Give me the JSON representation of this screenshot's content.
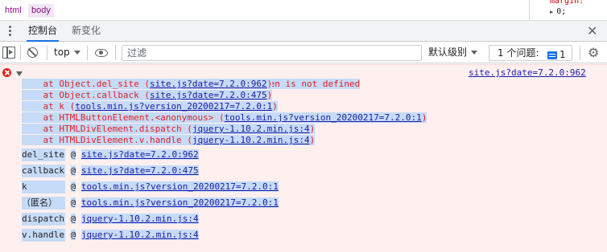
{
  "breadcrumbs": [
    "html",
    "body"
  ],
  "styles_peek": {
    "property": "margin:",
    "value": "0;"
  },
  "drawer": {
    "tabs": [
      {
        "label": "控制台",
        "active": true
      },
      {
        "label": "新变化",
        "active": false
      }
    ],
    "close_glyph": "✕"
  },
  "toolbar": {
    "context": "top",
    "filter_placeholder": "过滤",
    "levels_label": "默认级别",
    "issues_label": "1 个问题:",
    "issues_count": "1",
    "gear_glyph": "⚙"
  },
  "error": {
    "header": "Uncaught ReferenceError: recycle_bin_db_open is not defined",
    "source": "site.js?date=7.2.0:962",
    "frames": [
      {
        "prefix": "    at Object.del_site (",
        "link": "site.js?date=7.2.0:962",
        "suffix": ")"
      },
      {
        "prefix": "    at Object.callback (",
        "link": "site.js?date=7.2.0:475",
        "suffix": ")"
      },
      {
        "prefix": "    at k (",
        "link": "tools.min.js?version_20200217=7.2.0:1",
        "suffix": ")"
      },
      {
        "prefix": "    at HTMLButtonElement.<anonymous> (",
        "link": "tools.min.js?version_20200217=7.2.0:1",
        "suffix": ")"
      },
      {
        "prefix": "    at HTMLDivElement.dispatch (",
        "link": "jquery-1.10.2.min.js:4",
        "suffix": ")"
      },
      {
        "prefix": "    at HTMLDivElement.v.handle (",
        "link": "jquery-1.10.2.min.js:4",
        "suffix": ")"
      }
    ],
    "stack_table": [
      {
        "fn": "del_site",
        "at": "@",
        "link": "site.js?date=7.2.0:962"
      },
      {
        "fn": "callback",
        "at": "@",
        "link": "site.js?date=7.2.0:475"
      },
      {
        "fn": "k",
        "at": "@",
        "link": "tools.min.js?version_20200217=7.2.0:1"
      },
      {
        "fn": "（匿名）",
        "at": "@",
        "link": "tools.min.js?version_20200217=7.2.0:1"
      },
      {
        "fn": "dispatch",
        "at": "@",
        "link": "jquery-1.10.2.min.js:4"
      },
      {
        "fn": "v.handle",
        "at": "@",
        "link": "jquery-1.10.2.min.js:4"
      }
    ]
  },
  "colors": {
    "error_red": "#e41e1e",
    "error_bg": "#fff0f0",
    "link_blue": "#1a1aa6",
    "selection": "#c6dbf7",
    "accent": "#1a73e8"
  }
}
